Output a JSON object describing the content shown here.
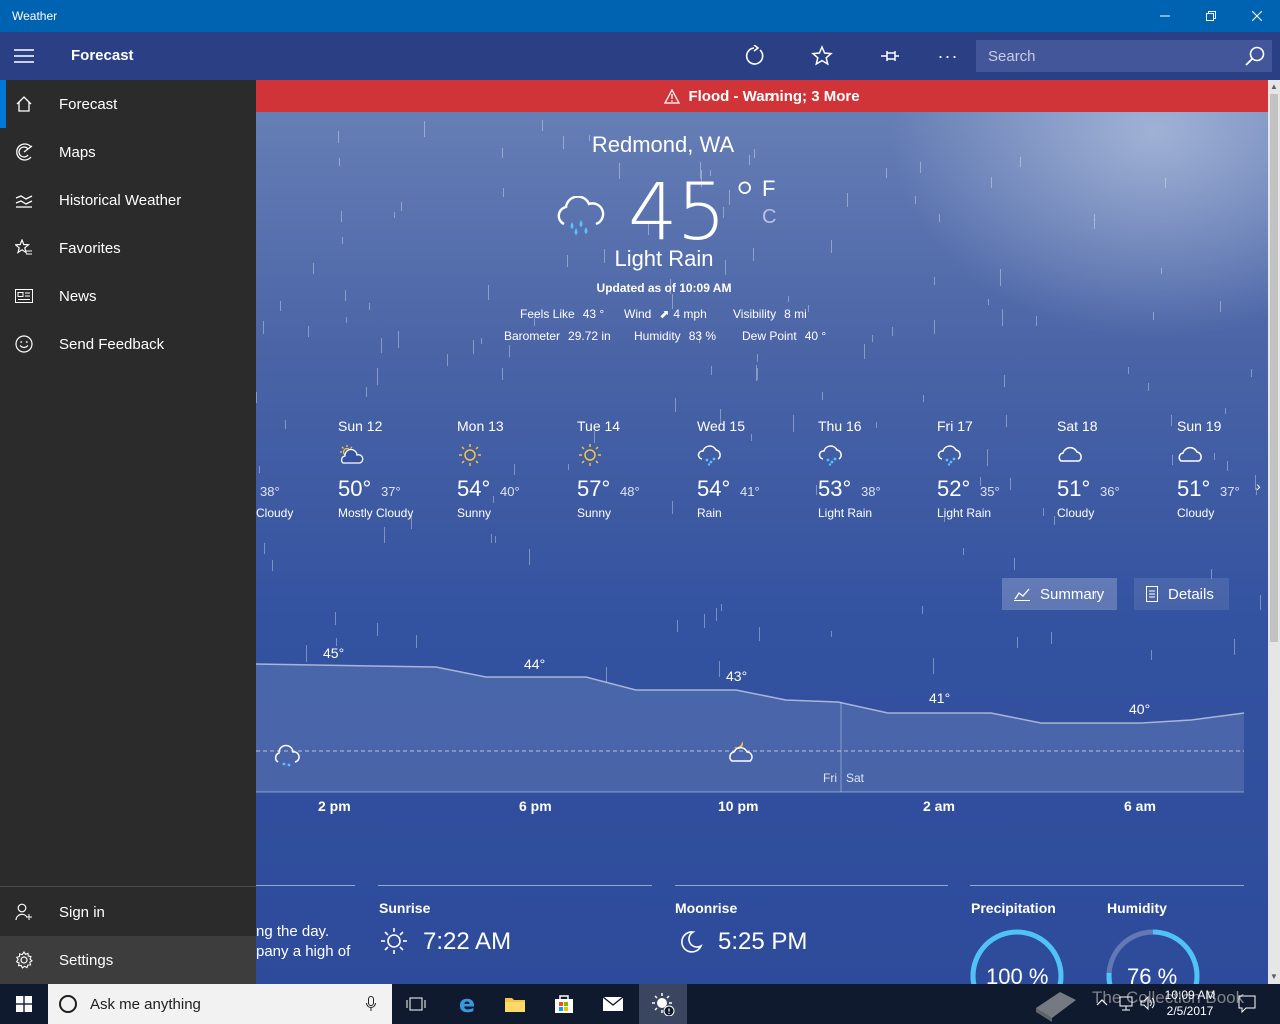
{
  "window": {
    "title": "Weather"
  },
  "appbar": {
    "title": "Forecast",
    "search_placeholder": "Search"
  },
  "nav": {
    "items": [
      {
        "label": "Forecast",
        "icon": "home-icon"
      },
      {
        "label": "Maps",
        "icon": "radar-icon"
      },
      {
        "label": "Historical Weather",
        "icon": "chart-icon"
      },
      {
        "label": "Favorites",
        "icon": "star-list-icon"
      },
      {
        "label": "News",
        "icon": "news-icon"
      },
      {
        "label": "Send Feedback",
        "icon": "smiley-icon"
      }
    ],
    "bottom": [
      {
        "label": "Sign in",
        "icon": "person-add-icon"
      },
      {
        "label": "Settings",
        "icon": "gear-icon"
      }
    ]
  },
  "alert": {
    "text": "Flood - Warning; 3 More",
    "color": "#d13438"
  },
  "current": {
    "location": "Redmond, WA",
    "temperature": "45",
    "degree": "°",
    "unit_f": "F",
    "unit_c": "C",
    "condition": "Light Rain",
    "updated": "Updated as of 10:09 AM",
    "feels_like_label": "Feels Like",
    "feels_like": "43 °",
    "wind_label": "Wind",
    "wind": "4 mph",
    "visibility_label": "Visibility",
    "visibility": "8 mi",
    "barometer_label": "Barometer",
    "barometer": "29.72 in",
    "humidity_label": "Humidity",
    "humidity": "83 %",
    "dew_point_label": "Dew Point",
    "dew_point": "40 °"
  },
  "partial_day": {
    "lo": "38°",
    "desc": "Cloudy"
  },
  "days": [
    {
      "name": "Sun 12",
      "hi": "50°",
      "lo": "37°",
      "desc": "Mostly Cloudy",
      "icon": "partly-sunny"
    },
    {
      "name": "Mon 13",
      "hi": "54°",
      "lo": "40°",
      "desc": "Sunny",
      "icon": "sunny"
    },
    {
      "name": "Tue 14",
      "hi": "57°",
      "lo": "48°",
      "desc": "Sunny",
      "icon": "sunny"
    },
    {
      "name": "Wed 15",
      "hi": "54°",
      "lo": "41°",
      "desc": "Rain",
      "icon": "rain"
    },
    {
      "name": "Thu 16",
      "hi": "53°",
      "lo": "38°",
      "desc": "Light Rain",
      "icon": "rain"
    },
    {
      "name": "Fri 17",
      "hi": "52°",
      "lo": "35°",
      "desc": "Light Rain",
      "icon": "rain"
    },
    {
      "name": "Sat 18",
      "hi": "51°",
      "lo": "36°",
      "desc": "Cloudy",
      "icon": "cloudy"
    },
    {
      "name": "Sun 19",
      "hi": "51°",
      "lo": "37°",
      "desc": "Cloudy",
      "icon": "cloudy"
    }
  ],
  "view_buttons": {
    "summary": "Summary",
    "details": "Details"
  },
  "hourly": {
    "hour_labels": [
      "2 pm",
      "6 pm",
      "10 pm",
      "2 am",
      "6 am"
    ],
    "temp_labels": [
      "45°",
      "44°",
      "43°",
      "41°",
      "40°"
    ],
    "day_markers": [
      "Fri",
      "Sat"
    ]
  },
  "cards": {
    "partial_text_1": "ng the day.",
    "partial_text_2": "pany a high of",
    "sunrise_label": "Sunrise",
    "sunrise": "7:22 AM",
    "moonrise_label": "Moonrise",
    "moonrise": "5:25 PM",
    "precip_label": "Precipitation",
    "precip": "100 %",
    "precip_fraction": 1.0,
    "humidity_label": "Humidity",
    "humidity": "76 %",
    "humidity_fraction": 0.76
  },
  "taskbar": {
    "search_placeholder": "Ask me anything",
    "time": "10:09 AM",
    "date": "2/5/2017",
    "watermark": "The Collection Book"
  },
  "colors": {
    "accent": "#0078d7",
    "titlebar": "#0063b1",
    "appbar": "#2b3f84",
    "nav": "#2b2b2b",
    "ring": "#4fc3f7"
  }
}
